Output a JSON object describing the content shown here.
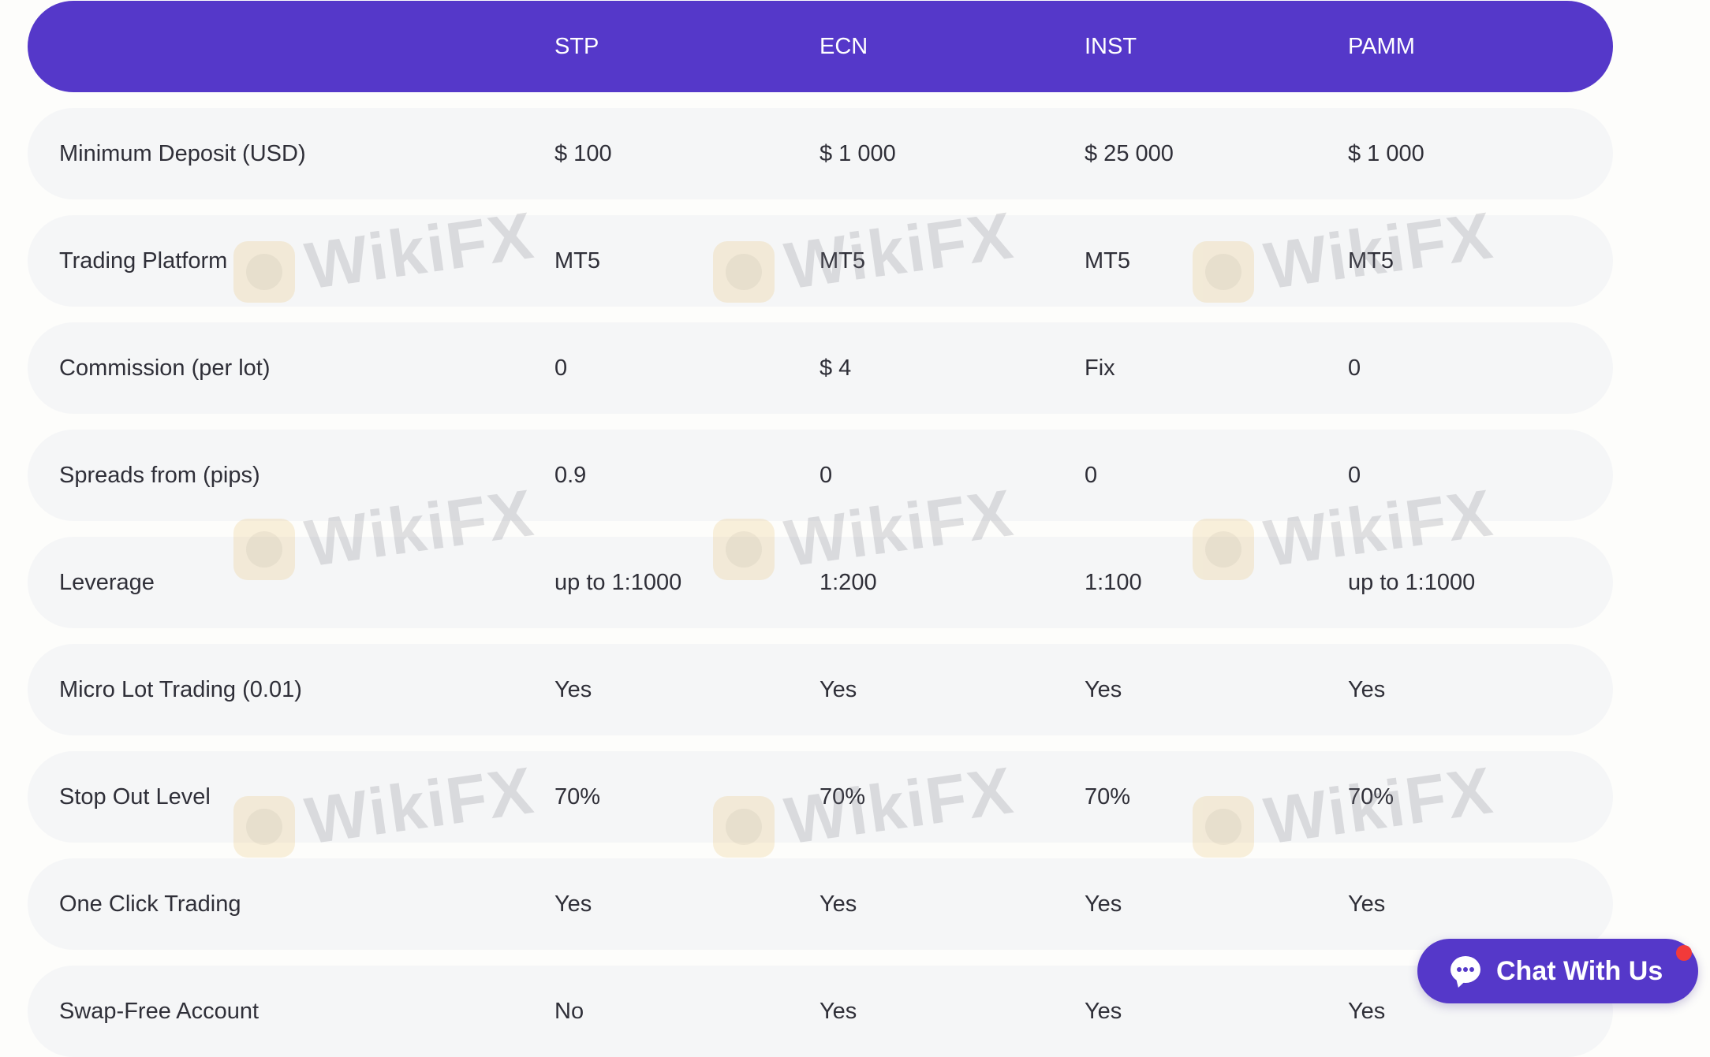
{
  "header": {
    "columns": [
      "",
      "STP",
      "ECN",
      "INST",
      "PAMM"
    ]
  },
  "rows": [
    {
      "label": "Minimum Deposit (USD)",
      "values": [
        "$ 100",
        "$ 1 000",
        "$ 25 000",
        "$ 1 000"
      ]
    },
    {
      "label": "Trading Platform",
      "values": [
        "MT5",
        "MT5",
        "MT5",
        "MT5"
      ]
    },
    {
      "label": "Commission (per lot)",
      "values": [
        "0",
        "$ 4",
        "Fix",
        "0"
      ]
    },
    {
      "label": "Spreads from (pips)",
      "values": [
        "0.9",
        "0",
        "0",
        "0"
      ]
    },
    {
      "label": "Leverage",
      "values": [
        "up to 1:1000",
        "1:200",
        "1:100",
        "up to 1:1000"
      ]
    },
    {
      "label": "Micro Lot Trading (0.01)",
      "values": [
        "Yes",
        "Yes",
        "Yes",
        "Yes"
      ]
    },
    {
      "label": "Stop Out Level",
      "values": [
        "70%",
        "70%",
        "70%",
        "70%"
      ]
    },
    {
      "label": "One Click Trading",
      "values": [
        "Yes",
        "Yes",
        "Yes",
        "Yes"
      ]
    },
    {
      "label": "Swap-Free Account",
      "values": [
        "No",
        "Yes",
        "Yes",
        "Yes"
      ]
    }
  ],
  "watermark": {
    "text": "WikiFX"
  },
  "chat": {
    "label": "Chat With Us",
    "icon": "chat-bubble-icon"
  },
  "colors": {
    "header_background": "#5538c9",
    "row_background": "#f5f6f7",
    "chat_button": "#5538c9",
    "notification": "#f23a3a"
  }
}
